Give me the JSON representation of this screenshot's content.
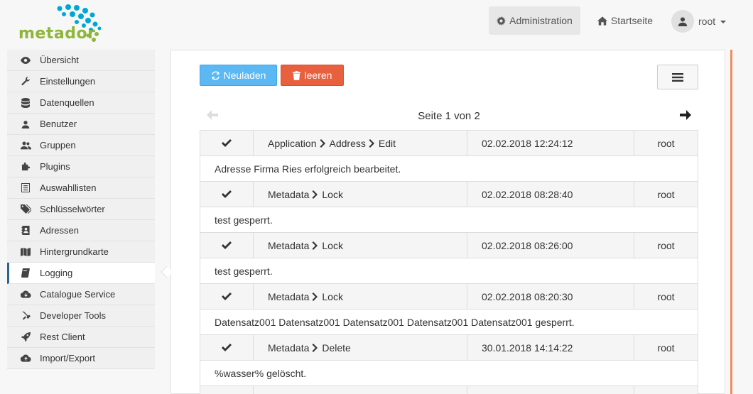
{
  "app": {
    "logo_text": "metador"
  },
  "topnav": {
    "admin_label": "Administration",
    "home_label": "Startseite",
    "user_label": "root"
  },
  "sidebar": {
    "items": [
      {
        "label": "Übersicht",
        "icon": "eye-icon"
      },
      {
        "label": "Einstellungen",
        "icon": "wrench-icon"
      },
      {
        "label": "Datenquellen",
        "icon": "database-icon"
      },
      {
        "label": "Benutzer",
        "icon": "user-icon"
      },
      {
        "label": "Gruppen",
        "icon": "users-icon"
      },
      {
        "label": "Plugins",
        "icon": "puzzle-icon"
      },
      {
        "label": "Auswahllisten",
        "icon": "list-icon"
      },
      {
        "label": "Schlüsselwörter",
        "icon": "tags-icon"
      },
      {
        "label": "Adressen",
        "icon": "address-book-icon"
      },
      {
        "label": "Hintergrundkarte",
        "icon": "map-icon"
      },
      {
        "label": "Logging",
        "icon": "book-icon",
        "active": true
      },
      {
        "label": "Catalogue Service",
        "icon": "cloud-download-icon"
      },
      {
        "label": "Developer Tools",
        "icon": "tools-icon"
      },
      {
        "label": "Rest Client",
        "icon": "rocket-icon"
      },
      {
        "label": "Import/Export",
        "icon": "cloud-upload-icon"
      }
    ]
  },
  "toolbar": {
    "reload_label": "Neuladen",
    "clear_label": "leeren"
  },
  "pager": {
    "text": "Seite 1 von 2"
  },
  "logs": [
    {
      "crumbs": [
        "Application",
        "Address",
        "Edit"
      ],
      "date": "02.02.2018 12:24:12",
      "user": "root",
      "message": "Adresse Firma Ries erfolgreich bearbeitet."
    },
    {
      "crumbs": [
        "Metadata",
        "Lock"
      ],
      "date": "02.02.2018 08:28:40",
      "user": "root",
      "message": "test gesperrt."
    },
    {
      "crumbs": [
        "Metadata",
        "Lock"
      ],
      "date": "02.02.2018 08:26:00",
      "user": "root",
      "message": "test gesperrt."
    },
    {
      "crumbs": [
        "Metadata",
        "Lock"
      ],
      "date": "02.02.2018 08:20:30",
      "user": "root",
      "message": "Datensatz001 Datensatz001 Datensatz001 Datensatz001 Datensatz001 gesperrt."
    },
    {
      "crumbs": [
        "Metadata",
        "Delete"
      ],
      "date": "30.01.2018 14:14:22",
      "user": "root",
      "message": "%wasser% gelöscht."
    }
  ],
  "colors": {
    "brand_green": "#8fb53a",
    "brand_blue": "#00a6d6",
    "reload_blue": "#5cb8f2",
    "clear_red": "#e9603f",
    "accent_orange": "#ee8c5c"
  }
}
